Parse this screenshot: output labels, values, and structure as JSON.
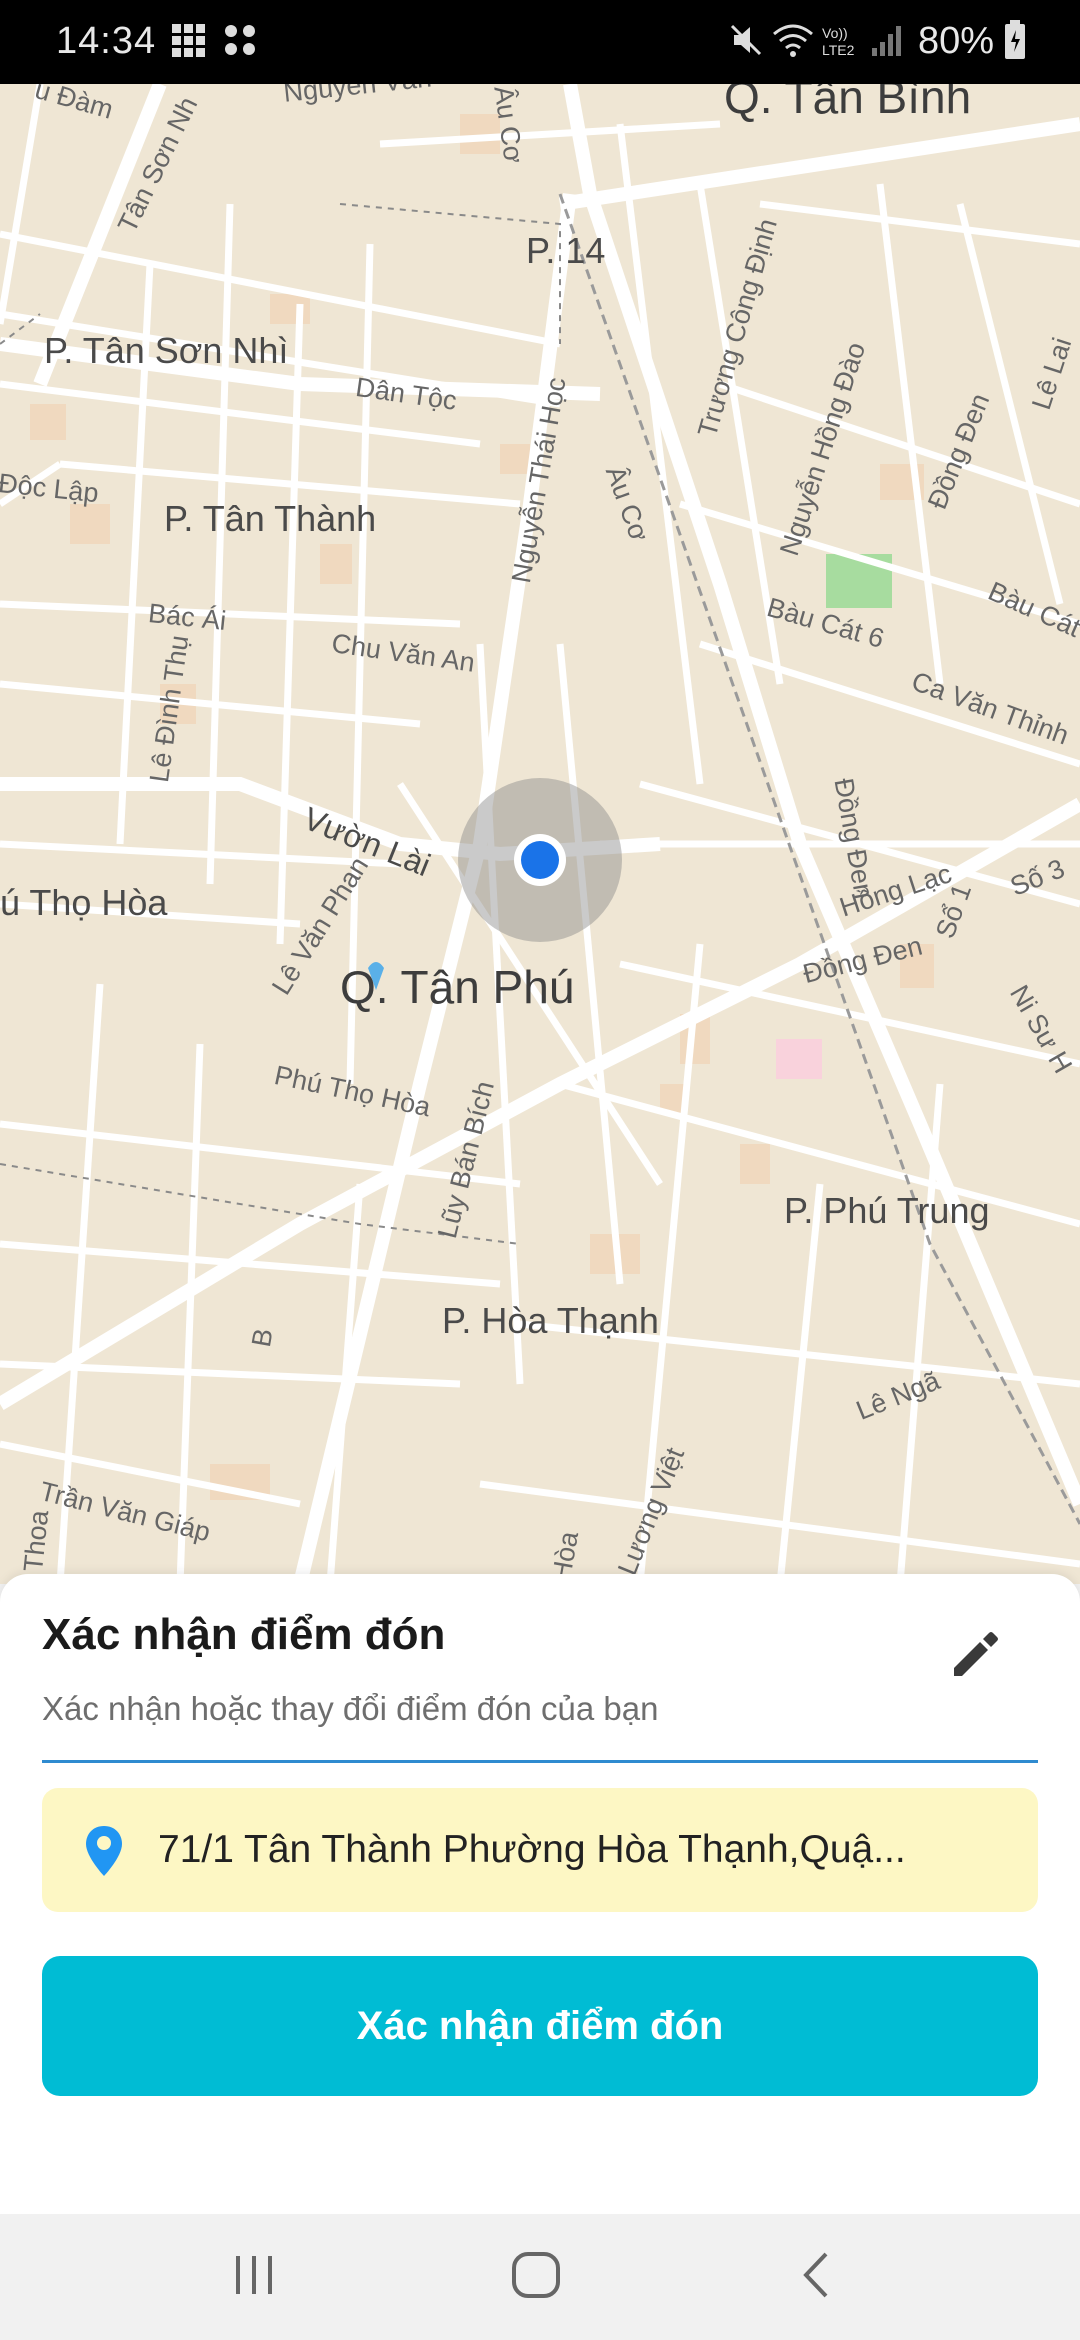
{
  "status_bar": {
    "time": "14:34",
    "icons": [
      "grid-icon",
      "four-dots-icon",
      "mute-icon",
      "wifi-icon",
      "volte-lte2-icon",
      "signal-icon",
      "battery-icon"
    ],
    "network": "Vo)) LTE2",
    "battery": "80%"
  },
  "map": {
    "district_labels": [
      "Q. Tân Bình",
      "Q. Tân Phú"
    ],
    "area_labels": [
      "P. 14",
      "P. Tân Sơn Nhì",
      "P. Tân Thành",
      "ú Thọ Hòa",
      "P. Phú Trung",
      "P. Hòa Thạnh"
    ],
    "street_labels": [
      "Nguyễn Văn",
      "Tân Sơn Nh",
      "u Đàm",
      "Âu Cơ",
      "Trương Công Định",
      "Nguyễn Hồng Đào",
      "Dân Tộc",
      "Nguyễn Thái Học",
      "Độc Lập",
      "Âu Cơ",
      "Đồng Đen",
      "Lê Lai",
      "Bàu Cát",
      "Bác Ái",
      "Chu Văn An",
      "Bàu Cát 6",
      "Lê Đình Thụ",
      "Đồng Đen",
      "Ca Văn Thỉnh",
      "Vườn Lài",
      "Hồng Lạc",
      "Số 3",
      "Sổ 1",
      "Lê Văn Phan",
      "Đồng Đen",
      "Ni Sư H",
      "Phú Thọ Hòa",
      "Lũy Bán Bích",
      "B",
      "Lê Ngã",
      "Trần Văn Giáp",
      "Thoa",
      "Lương Việt",
      "Hòa"
    ],
    "location_marker": "current-location"
  },
  "sheet": {
    "title": "Xác nhận điểm đón",
    "subtitle": "Xác nhận hoặc thay đổi điểm đón của bạn",
    "edit_icon": "pencil-icon",
    "address": "71/1 Tân Thành Phường Hòa Thạnh,Quậ...",
    "address_icon": "location-pin-icon",
    "confirm_button": "Xác nhận điểm đón"
  },
  "nav_bar": {
    "buttons": [
      "recent-apps-icon",
      "home-icon",
      "back-icon"
    ]
  },
  "colors": {
    "accent": "#00bcd4",
    "divider": "#2f8bd0",
    "address_bg": "#fdf7c4",
    "pin": "#2196f3",
    "map_bg": "#efe6d4",
    "marker": "#1a73e8"
  }
}
